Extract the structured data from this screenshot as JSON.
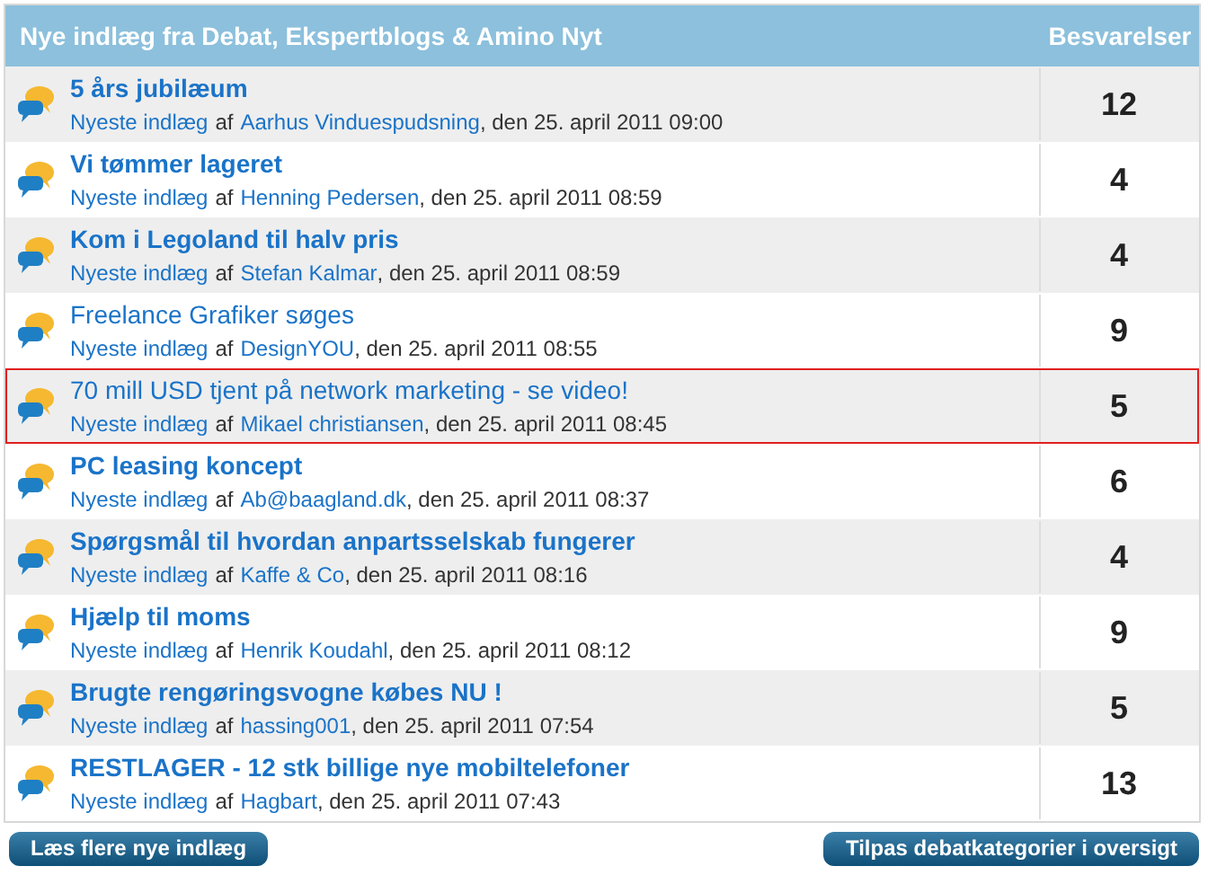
{
  "header": {
    "title": "Nye indlæg fra Debat, Ekspertblogs & Amino Nyt",
    "count_heading": "Besvarelser"
  },
  "rows": [
    {
      "title": "5 års jubilæum",
      "bold": true,
      "selected": false,
      "label": "Nyeste indlæg",
      "by": "af",
      "author": "Aarhus Vinduespudsning",
      "date": ", den 25. april 2011 09:00",
      "count": "12"
    },
    {
      "title": "Vi tømmer lageret",
      "bold": true,
      "selected": false,
      "label": "Nyeste indlæg",
      "by": "af",
      "author": "Henning Pedersen",
      "date": ", den 25. april 2011 08:59",
      "count": "4"
    },
    {
      "title": "Kom i Legoland til halv pris",
      "bold": true,
      "selected": false,
      "label": "Nyeste indlæg",
      "by": "af",
      "author": "Stefan Kalmar",
      "date": ", den 25. april 2011 08:59",
      "count": "4"
    },
    {
      "title": "Freelance Grafiker søges",
      "bold": false,
      "selected": false,
      "label": "Nyeste indlæg",
      "by": "af",
      "author": "DesignYOU",
      "date": ", den 25. april 2011 08:55",
      "count": "9"
    },
    {
      "title": "70 mill USD tjent på network marketing - se video!",
      "bold": false,
      "selected": true,
      "label": "Nyeste indlæg",
      "by": "af",
      "author": "Mikael christiansen",
      "date": ", den 25. april 2011 08:45",
      "count": "5"
    },
    {
      "title": "PC leasing koncept",
      "bold": true,
      "selected": false,
      "label": "Nyeste indlæg",
      "by": "af",
      "author": "Ab@baagland.dk",
      "date": ", den 25. april 2011 08:37",
      "count": "6"
    },
    {
      "title": "Spørgsmål til hvordan anpartsselskab fungerer",
      "bold": true,
      "selected": false,
      "label": "Nyeste indlæg",
      "by": "af",
      "author": "Kaffe & Co",
      "date": ", den 25. april 2011 08:16",
      "count": "4"
    },
    {
      "title": "Hjælp til moms",
      "bold": true,
      "selected": false,
      "label": "Nyeste indlæg",
      "by": "af",
      "author": "Henrik Koudahl",
      "date": ", den 25. april 2011 08:12",
      "count": "9"
    },
    {
      "title": "Brugte rengøringsvogne købes NU !",
      "bold": true,
      "selected": false,
      "label": "Nyeste indlæg",
      "by": "af",
      "author": "hassing001",
      "date": ", den 25. april 2011 07:54",
      "count": "5"
    },
    {
      "title": "RESTLAGER - 12 stk billige nye mobiltelefoner",
      "bold": true,
      "selected": false,
      "label": "Nyeste indlæg",
      "by": "af",
      "author": "Hagbart",
      "date": ", den 25. april 2011 07:43",
      "count": "13"
    }
  ],
  "buttons": [
    "Læs flere nye indlæg",
    "Tilpas debatkategorier i oversigt"
  ]
}
